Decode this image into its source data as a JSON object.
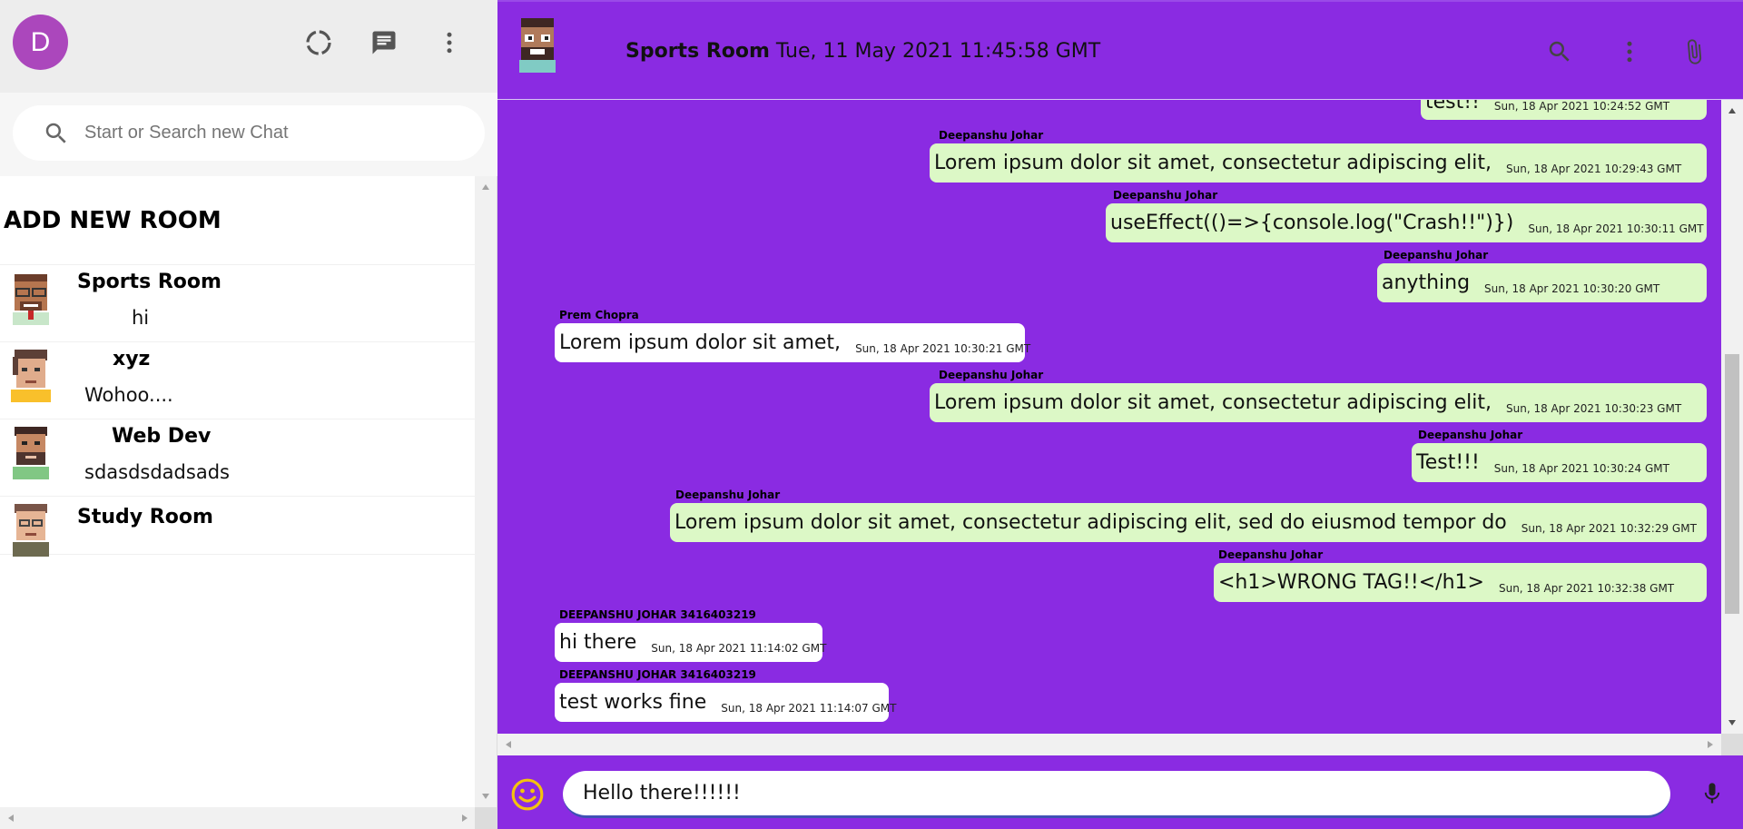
{
  "user": {
    "avatar_letter": "D"
  },
  "search": {
    "placeholder": "Start or Search new Chat"
  },
  "sidebar": {
    "add_room_label": "ADD NEW ROOM",
    "rooms": [
      {
        "name": "Sports Room",
        "last_message": "hi"
      },
      {
        "name": "xyz",
        "last_message": "Wohoo...."
      },
      {
        "name": "Web Dev",
        "last_message": "sdasdsdadsads"
      },
      {
        "name": "Study Room",
        "last_message": ""
      }
    ]
  },
  "chat": {
    "room_name": "Sports Room",
    "last_seen": "Tue, 11 May 2021 11:45:58 GMT",
    "messages": [
      {
        "sender": "",
        "text": "test!!",
        "timestamp": "Sun, 18 Apr 2021 10:24:52 GMT",
        "type": "sent"
      },
      {
        "sender": "Deepanshu Johar",
        "text": "Lorem ipsum dolor sit amet, consectetur adipiscing elit,",
        "timestamp": "Sun, 18 Apr 2021 10:29:43 GMT",
        "type": "sent"
      },
      {
        "sender": "Deepanshu Johar",
        "text": "useEffect(()=>{console.log(\"Crash!!\")})",
        "timestamp": "Sun, 18 Apr 2021 10:30:11 GMT",
        "type": "sent"
      },
      {
        "sender": "Deepanshu Johar",
        "text": "anything",
        "timestamp": "Sun, 18 Apr 2021 10:30:20 GMT",
        "type": "sent"
      },
      {
        "sender": "Prem Chopra",
        "text": "Lorem ipsum dolor sit amet,",
        "timestamp": "Sun, 18 Apr 2021 10:30:21 GMT",
        "type": "received"
      },
      {
        "sender": "Deepanshu Johar",
        "text": "Lorem ipsum dolor sit amet, consectetur adipiscing elit,",
        "timestamp": "Sun, 18 Apr 2021 10:30:23 GMT",
        "type": "sent"
      },
      {
        "sender": "Deepanshu Johar",
        "text": "Test!!!",
        "timestamp": "Sun, 18 Apr 2021 10:30:24 GMT",
        "type": "sent"
      },
      {
        "sender": "Deepanshu Johar",
        "text": "Lorem ipsum dolor sit amet, consectetur adipiscing elit, sed do eiusmod tempor do",
        "timestamp": "Sun, 18 Apr 2021 10:32:29 GMT",
        "type": "sent"
      },
      {
        "sender": "Deepanshu Johar",
        "text": "<h1>WRONG TAG!!</h1>",
        "timestamp": "Sun, 18 Apr 2021 10:32:38 GMT",
        "type": "sent"
      },
      {
        "sender": "DEEPANSHU JOHAR 3416403219",
        "text": "hi there",
        "timestamp": "Sun, 18 Apr 2021 11:14:02 GMT",
        "type": "received"
      },
      {
        "sender": "DEEPANSHU JOHAR 3416403219",
        "text": "test works fine",
        "timestamp": "Sun, 18 Apr 2021 11:14:07 GMT",
        "type": "received"
      }
    ]
  },
  "composer": {
    "value": "Hello there!!!!!!"
  },
  "icons": {
    "status": "status-icon",
    "new_chat": "chat-icon",
    "menu": "more-vert-icon",
    "search": "search-icon",
    "attach": "attach-icon",
    "emoji": "emoji-icon",
    "mic": "mic-icon"
  },
  "colors": {
    "chat_background": "#8a2be2",
    "sent_bubble": "#dcf8c6",
    "received_bubble": "#ffffff",
    "user_avatar": "#ab47bc",
    "emoji": "#f4c20d"
  }
}
